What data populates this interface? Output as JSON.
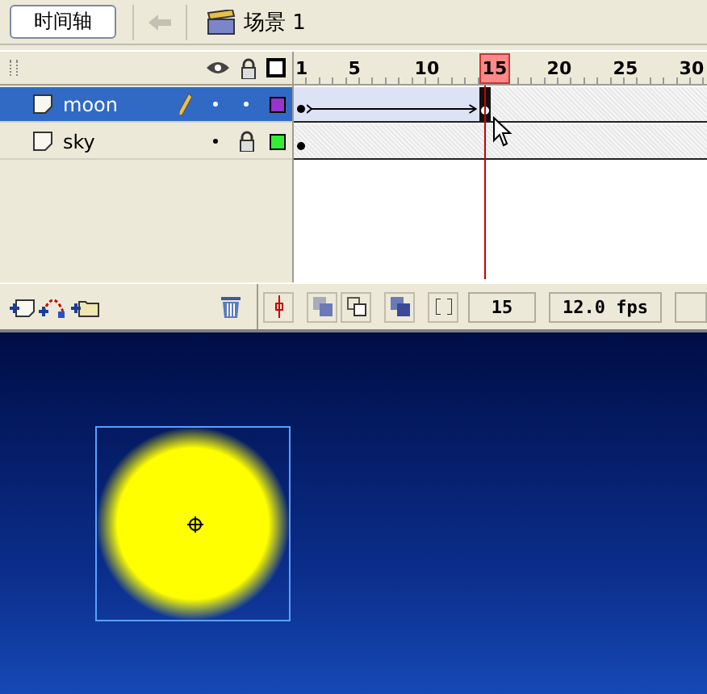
{
  "toolbar": {
    "timeline_button": "时间轴",
    "scene": "场景 1"
  },
  "ruler": [
    {
      "text": "1",
      "selected": false
    },
    {
      "text": "5",
      "selected": false
    },
    {
      "text": "10",
      "selected": false
    },
    {
      "text": "15",
      "selected": true
    },
    {
      "text": "20",
      "selected": false
    },
    {
      "text": "25",
      "selected": false
    },
    {
      "text": "30",
      "selected": false
    }
  ],
  "layers": [
    {
      "name": "moon",
      "selected": true,
      "editing": true,
      "visible": true,
      "locked": false,
      "color": "#9933cc",
      "tween": true
    },
    {
      "name": "sky",
      "selected": false,
      "editing": false,
      "visible": true,
      "locked": true,
      "color": "#33ee33",
      "tween": false
    }
  ],
  "status": {
    "frame": "15",
    "fps": "12.0 fps"
  }
}
